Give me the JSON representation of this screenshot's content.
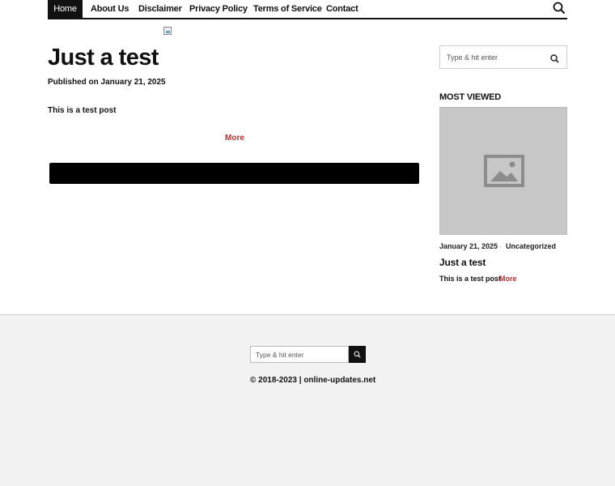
{
  "nav": {
    "items": [
      {
        "label": "Home",
        "active": true
      },
      {
        "label": "About Us"
      },
      {
        "label": "Disclaimer"
      },
      {
        "label": "Privacy Policy"
      },
      {
        "label": "Terms of Service"
      },
      {
        "label": "Contact"
      }
    ],
    "search_icon": "search-icon"
  },
  "article": {
    "title": "Just a test",
    "meta": "Published on January 21, 2025",
    "body": "This is a test post",
    "more": "More"
  },
  "sidebar": {
    "search_placeholder": "Type & hit enter",
    "widget_title": "MOST VIEWED",
    "post": {
      "date": "January 21, 2025",
      "separator": "·",
      "category": "Uncategorized",
      "title": "Just a test",
      "excerpt": "This is a test post",
      "more": "More"
    }
  },
  "footer": {
    "search_placeholder": "Type & hit enter",
    "copyright": "© 2018-2023 | online-updates.net"
  },
  "colors": {
    "accent": "#c62828",
    "dark": "#111111",
    "thumb_bg": "#c7c7c7"
  }
}
